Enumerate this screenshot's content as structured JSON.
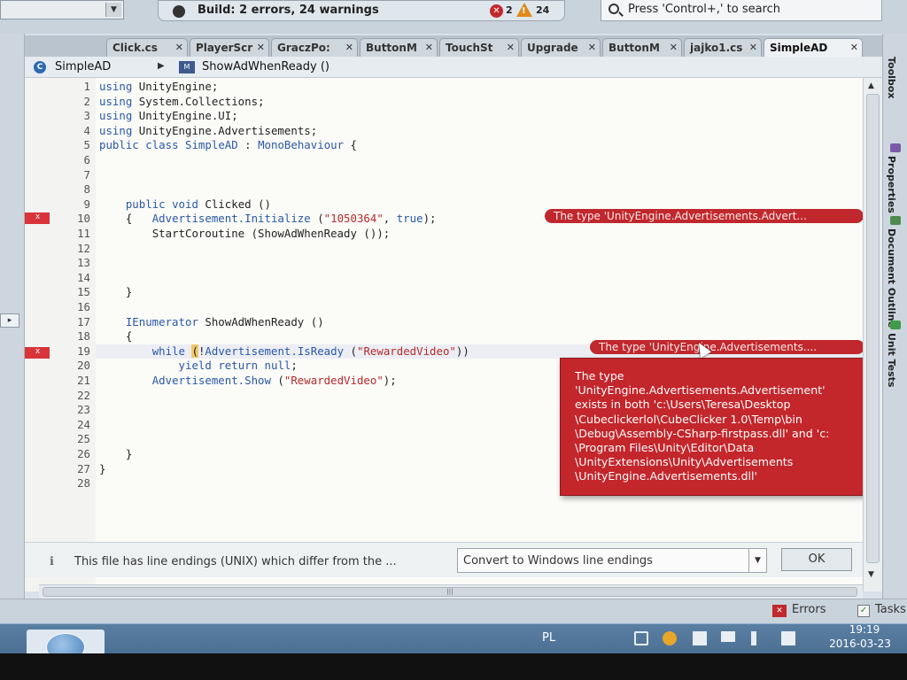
{
  "toolbar": {
    "build_status": "Build: 2 errors, 24 warnings",
    "error_count": "2",
    "warning_count": "24",
    "search_placeholder": "Press 'Control+,' to search"
  },
  "tabs": [
    {
      "label": "Click.cs",
      "active": false
    },
    {
      "label": "PlayerScr",
      "active": false
    },
    {
      "label": "GraczPo:",
      "active": false
    },
    {
      "label": "ButtonM",
      "active": false
    },
    {
      "label": "TouchSt",
      "active": false
    },
    {
      "label": "Upgrade",
      "active": false
    },
    {
      "label": "ButtonM",
      "active": false
    },
    {
      "label": "jajko1.cs",
      "active": false
    },
    {
      "label": "SimpleAD",
      "active": true
    }
  ],
  "breadcrumb": {
    "class_name": "SimpleAD",
    "method_name": "ShowAdWhenReady ()"
  },
  "editor": {
    "line_numbers": [
      "1",
      "2",
      "3",
      "4",
      "5",
      "6",
      "7",
      "8",
      "9",
      "10",
      "11",
      "12",
      "13",
      "14",
      "15",
      "16",
      "17",
      "18",
      "19",
      "20",
      "21",
      "22",
      "23",
      "24",
      "25",
      "26",
      "27",
      "28"
    ],
    "lines": {
      "l1": "UnityEngine;",
      "l2": "System.Collections;",
      "l3": "UnityEngine.UI;",
      "l4": "UnityEngine.Advertisements;",
      "l5_class": "SimpleAD",
      "l5_base": "MonoBehaviour",
      "l9_name": "Clicked",
      "l10_call": "Advertisement.Initialize",
      "l10_arg": "\"1050364\"",
      "l10_bool": "true",
      "l11": "StartCoroutine (ShowAdWhenReady ());",
      "l17_type": "IEnumerator",
      "l17_name": "ShowAdWhenReady",
      "l19_call": "Advertisement.IsReady",
      "l19_arg": "\"RewardedVideo\"",
      "l21_call": "Advertisement.Show",
      "l21_arg": "\"RewardedVideo\""
    },
    "kw": {
      "using": "using",
      "public": "public",
      "class": "class",
      "void": "void",
      "while": "while",
      "yield": "yield",
      "return": "return",
      "null": "null",
      "true": "true"
    },
    "error_bubble_1": "The type 'UnityEngine.Advertisements.Advert...",
    "error_bubble_2": "The type 'UnityEngine.Advertisements....",
    "tooltip": "The type\n'UnityEngine.Advertisements.Advertisement'\nexists in both 'c:\\Users\\Teresa\\Desktop\n\\Cubeclickerlol\\CubeClicker 1.0\\Temp\\bin\n\\Debug\\Assembly-CSharp-firstpass.dll' and 'c:\n\\Program Files\\Unity\\Editor\\Data\n\\UnityExtensions\\Unity\\Advertisements\n\\UnityEngine.Advertisements.dll'"
  },
  "right_dock": [
    "Toolbox",
    "Properties",
    "Document Outline",
    "Unit Tests"
  ],
  "notification": {
    "message": "This file has line endings (UNIX) which differ from the ...",
    "option": "Convert to Windows line endings",
    "ok_label": "OK"
  },
  "pads": {
    "errors_label": "Errors",
    "tasks_label": "Tasks"
  },
  "taskbar": {
    "language": "PL",
    "time": "19:19",
    "date": "2016-03-23"
  },
  "colors": {
    "error_red": "#c0282d",
    "keyword_blue": "#2a58a8",
    "string_red": "#b52a2a"
  }
}
